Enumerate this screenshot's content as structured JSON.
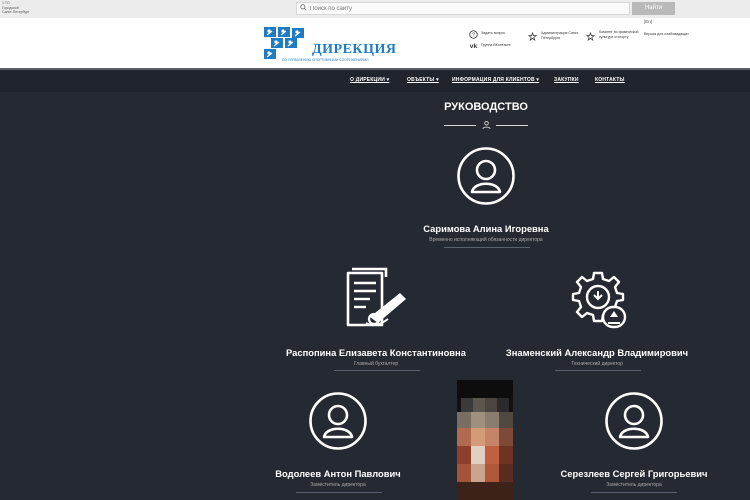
{
  "topbar": {
    "left_lines": [
      "1 ТО",
      "Городской",
      "Санкт-Петербург"
    ],
    "search_placeholder": "Поиск по сайту",
    "find_button": "Найти"
  },
  "header": {
    "logo_title": "ДИРЕКЦИЯ",
    "logo_subtitle": "ПО УПРАВЛЕНИЮ СПОРТИВНЫМИ СООРУЖЕНИЯМИ",
    "items": [
      {
        "icon": "question-icon",
        "label": "Задать вопрос"
      },
      {
        "icon": "vk-icon",
        "label": "Группа ВКонтакте"
      },
      {
        "icon": "emblem-icon",
        "label": "Администрация Санкт-Петербурга"
      },
      {
        "icon": "emblem-icon",
        "label": "Комитет по физической культуре и спорту"
      }
    ],
    "lang": "[En]",
    "accessible": "Версия для слабовидящих"
  },
  "nav": {
    "items": [
      "О ДИРЕКЦИИ",
      "ОБЪЕКТЫ",
      "ИНФОРМАЦИЯ ДЛЯ КЛИЕНТОВ",
      "ЗАКУПКИ",
      "КОНТАКТЫ"
    ]
  },
  "main": {
    "title": "РУКОВОДСТВО",
    "people": [
      {
        "name": "Саримова Алина Игоревна",
        "role": "Временно исполняющий обязанности директора",
        "icon": "user-avatar-icon"
      },
      {
        "name": "Распопина Елизавета Константиновна",
        "role": "Главный бухгалтер",
        "icon": "document-signature-icon"
      },
      {
        "name": "Знаменский Александр Владимирович",
        "role": "Технический директор",
        "icon": "gear-technical-icon"
      },
      {
        "name": "Водолеев Антон Павлович",
        "role": "Заместитель директора",
        "icon": "user-avatar-icon"
      },
      {
        "name": "Серезлеев Сергей Григорьевич",
        "role": "Заместитель директора",
        "icon": "user-avatar-icon"
      }
    ]
  }
}
